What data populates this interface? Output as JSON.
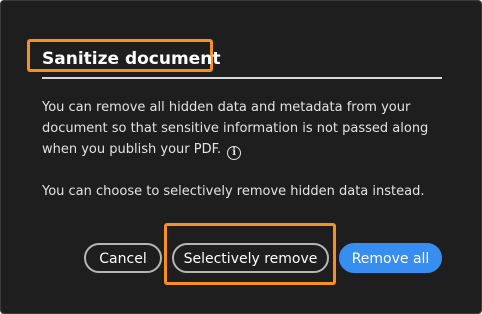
{
  "dialog": {
    "title": "Sanitize document",
    "description": "You can remove all hidden data and metadata from your document so that sensitive information is not passed along when you publish your PDF.",
    "info_icon": "i",
    "secondary_description": "You can choose to selectively remove hidden data instead."
  },
  "buttons": {
    "cancel": "Cancel",
    "selectively_remove": "Selectively remove",
    "remove_all": "Remove all"
  },
  "colors": {
    "background": "#1e1e1e",
    "primary_button": "#378ef0",
    "highlight": "#f7901e"
  },
  "icons": {
    "info": "info-icon"
  }
}
